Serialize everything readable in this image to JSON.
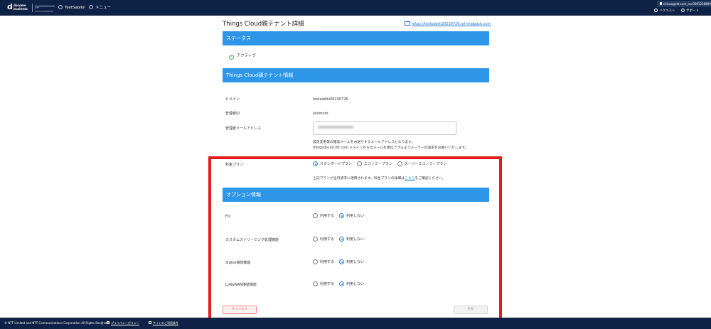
{
  "header": {
    "logo": {
      "line1": "docomo",
      "line2": "business"
    },
    "brand2": "NTT Communications",
    "breadcrumb": [
      "TestSabiki",
      "メニュー"
    ],
    "user_email": "chicaa@ntt.com_acc0001228890",
    "links": {
      "request": "リクエスト",
      "support": "サポート"
    }
  },
  "page": {
    "title": "Things Cloud親テナント詳細",
    "external_link": "https://testsabiki20230726.iot-trialpack.com"
  },
  "status_section": {
    "heading": "ステータス",
    "status": "アクティブ"
  },
  "tenant_section": {
    "heading": "Things Cloud親テナント情報",
    "domain_label": "ドメイン",
    "domain_value": "testsabiki20230726",
    "admin_id_label": "管理者ID",
    "admin_id_value": "ishimoto",
    "admin_email_label": "管理者メールアドレス",
    "admin_email_value": "",
    "note_line1": "設定変更等の確認メールをお送りするメールアドレスとなります。",
    "note_line2": "thingsdocud.ntt.com ドメインからのメールを受信できるようメーラーの設定をお願いいたします。"
  },
  "plan_section": {
    "label": "料金プラン",
    "options": [
      "スタンダードプラン",
      "エコノミープラン",
      "スーパーエコノミープラン"
    ],
    "selected": 0,
    "note_before": "上記プランが当月請求に適用されます。料金プランの詳細は",
    "note_link": "こちら",
    "note_after": "をご確認ください。"
  },
  "options_section": {
    "heading": "オプション情報",
    "use_label": "利用する",
    "nouse_label": "利用しない",
    "rows": [
      {
        "label": "FIC",
        "selected": "nouse"
      },
      {
        "label": "カスタムストリーミング処理機能",
        "selected": "nouse"
      },
      {
        "label": "Sigfox接続機能",
        "selected": "nouse"
      },
      {
        "label": "LoRaWAN接続機能",
        "selected": "nouse"
      }
    ]
  },
  "buttons": {
    "cancel": "キャンセル",
    "update": "更新"
  },
  "footer": {
    "copyright": "© NTT Limited and NTT Communications Corporation All Rights Reserved.",
    "privacy": "プライバシーポリシー",
    "terms": "サイトのご利用条件"
  },
  "colors": {
    "navy": "#0e2245",
    "accent_blue": "#2d96e8",
    "highlight_red": "#e51c1c"
  }
}
